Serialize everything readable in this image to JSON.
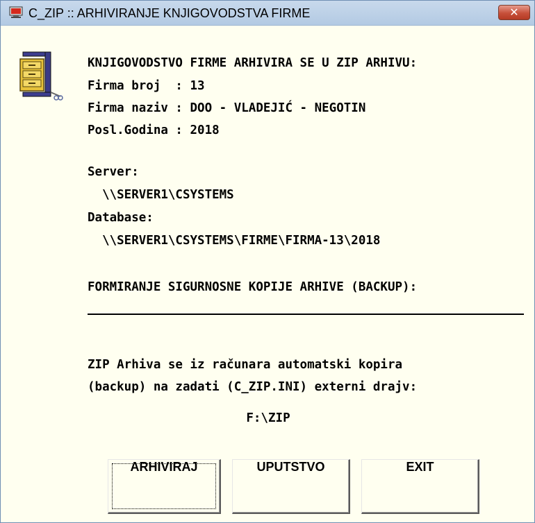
{
  "window": {
    "title": "C_ZIP :: ARHIVIRANJE KNJIGOVODSTVA FIRME",
    "close_symbol": "✕"
  },
  "icons": {
    "app": "computer-monitor-icon",
    "archive": "winzip-vice-icon"
  },
  "info": {
    "heading": "KNJIGOVODSTVO FIRME ARHIVIRA SE U ZIP ARHIVU:",
    "firma_broj": "Firma broj  : 13",
    "firma_naziv": "Firma naziv : DOO - VLADEJIĆ - NEGOTIN",
    "posl_godina": "Posl.Godina : 2018",
    "server_label": "Server:",
    "server_path": "  \\\\SERVER1\\CSYSTEMS",
    "database_label": "Database:",
    "database_path": "  \\\\SERVER1\\CSYSTEMS\\FIRME\\FIRMA-13\\2018"
  },
  "backup": {
    "heading": "FORMIRANJE SIGURNOSNE KOPIJE ARHIVE (BACKUP):",
    "line1": "ZIP Arhiva se iz računara automatski kopira",
    "line2": "(backup) na zadati (C_ZIP.INI) externi drajv:",
    "drive": "F:\\ZIP"
  },
  "buttons": {
    "archive": "ARHIVIRAJ",
    "help": "UPUTSTVO",
    "exit": "EXIT"
  },
  "colors": {
    "background": "#fffff0",
    "titlebar": "#b3cae3",
    "close": "#c7503a"
  }
}
